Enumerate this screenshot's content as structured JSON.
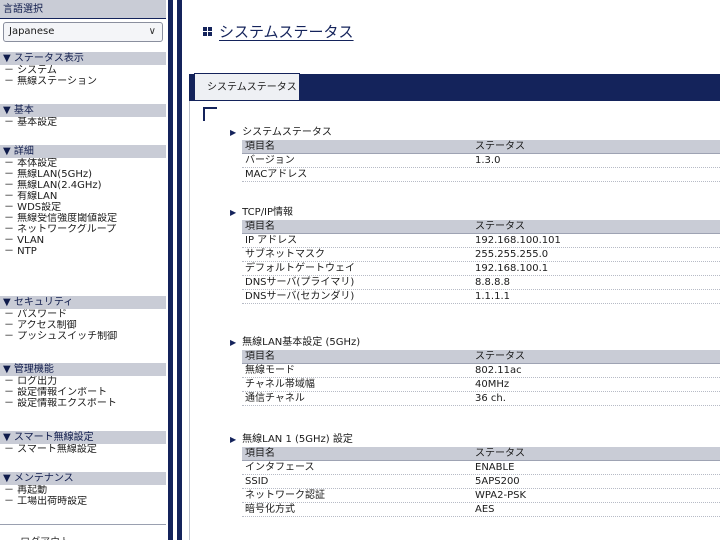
{
  "sidebar": {
    "language": {
      "title": "言語選択",
      "selected": "Japanese"
    },
    "sections": [
      {
        "title": "▼ ステータス表示",
        "items": [
          "－ システム",
          "－ 無線ステーション"
        ]
      },
      {
        "title": "▼ 基本",
        "items": [
          "－ 基本設定"
        ]
      },
      {
        "title": "▼ 詳細",
        "items": [
          "－ 本体設定",
          "－ 無線LAN(5GHz)",
          "－ 無線LAN(2.4GHz)",
          "－ 有線LAN",
          "－ WDS設定",
          "－ 無線受信強度閾値設定",
          "－ ネットワークグループ",
          "－ VLAN",
          "－ NTP"
        ]
      },
      {
        "title": "▼ セキュリティ",
        "items": [
          "－ パスワード",
          "－ アクセス制御",
          "－ プッシュスイッチ制御"
        ]
      },
      {
        "title": "▼ 管理機能",
        "items": [
          "－ ログ出力",
          "－ 設定情報インポート",
          "－ 設定情報エクスポート"
        ]
      },
      {
        "title": "▼ スマート無線設定",
        "items": [
          "－ スマート無線設定"
        ]
      },
      {
        "title": "▼ メンテナンス",
        "items": [
          "－ 再起動",
          "－ 工場出荷時設定"
        ]
      }
    ],
    "logout": "－ ログアウト"
  },
  "main": {
    "title": "システムステータス",
    "tab": "システムステータス",
    "column_name": "項目名",
    "column_status": "ステータス",
    "blocks": [
      {
        "title": "システムステータス",
        "rows": [
          {
            "name": "バージョン",
            "value": "1.3.0"
          },
          {
            "name": "MACアドレス",
            "value": ""
          }
        ]
      },
      {
        "title": "TCP/IP情報",
        "rows": [
          {
            "name": "IP アドレス",
            "value": "192.168.100.101"
          },
          {
            "name": "サブネットマスク",
            "value": "255.255.255.0"
          },
          {
            "name": "デフォルトゲートウェイ",
            "value": "192.168.100.1"
          },
          {
            "name": "DNSサーバ(プライマリ)",
            "value": "8.8.8.8"
          },
          {
            "name": "DNSサーバ(セカンダリ)",
            "value": "1.1.1.1"
          }
        ]
      },
      {
        "title": "無線LAN基本設定 (5GHz)",
        "rows": [
          {
            "name": "無線モード",
            "value": "802.11ac"
          },
          {
            "name": "チャネル帯域幅",
            "value": "40MHz"
          },
          {
            "name": "通信チャネル",
            "value": "36 ch."
          }
        ]
      },
      {
        "title": "無線LAN 1 (5GHz) 設定",
        "rows": [
          {
            "name": "インタフェース",
            "value": "ENABLE"
          },
          {
            "name": "SSID",
            "value": "5APS200"
          },
          {
            "name": "ネットワーク認証",
            "value": "WPA2-PSK"
          },
          {
            "name": "暗号化方式",
            "value": "AES"
          }
        ]
      }
    ]
  },
  "colors": {
    "navy": "#14235b",
    "header_gray": "#c9ccd6"
  }
}
